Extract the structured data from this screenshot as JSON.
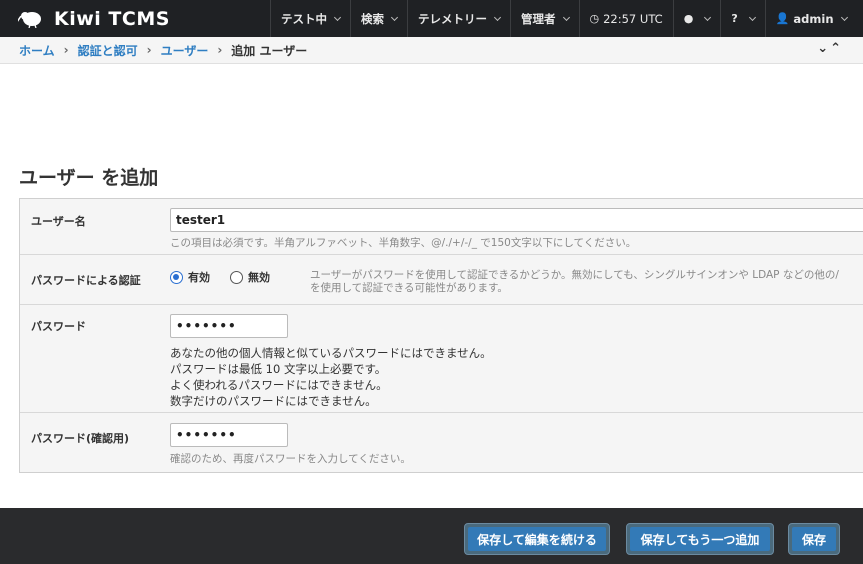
{
  "topbar": {
    "brand": "Kiwi TCMS",
    "nav": [
      {
        "label": "テスト中"
      },
      {
        "label": "検索"
      },
      {
        "label": "テレメトリー"
      },
      {
        "label": "管理者"
      }
    ],
    "clock": "22:57 UTC",
    "user": "admin"
  },
  "breadcrumb": {
    "home": "ホーム",
    "auth": "認証と認可",
    "users": "ユーザー",
    "current": "追加 ユーザー"
  },
  "page": {
    "title": "ユーザー を追加"
  },
  "form": {
    "username": {
      "label": "ユーザー名",
      "value": "tester1",
      "help": "この項目は必須です。半角アルファベット、半角数字、@/./+/-/_ で150文字以下にしてください。"
    },
    "password_auth": {
      "label": "パスワードによる認証",
      "enabled_label": "有効",
      "disabled_label": "無効",
      "help_line1": "ユーザーがパスワードを使用して認証できるかどうか。無効にしても、シングルサインオンや LDAP などの他の/",
      "help_line2": "を使用して認証できる可能性があります。"
    },
    "password": {
      "label": "パスワード",
      "value": "•••••••",
      "rules": [
        "あなたの他の個人情報と似ているパスワードにはできません。",
        "パスワードは最低 10 文字以上必要です。",
        "よく使われるパスワードにはできません。",
        "数字だけのパスワードにはできません。"
      ]
    },
    "password_confirm": {
      "label": "パスワード(確認用)",
      "value": "•••••••",
      "help": "確認のため、再度パスワードを入力してください。"
    }
  },
  "footer": {
    "save_continue": "保存して編集を続ける",
    "save_add_another": "保存してもう一つ追加",
    "save": "保存"
  }
}
